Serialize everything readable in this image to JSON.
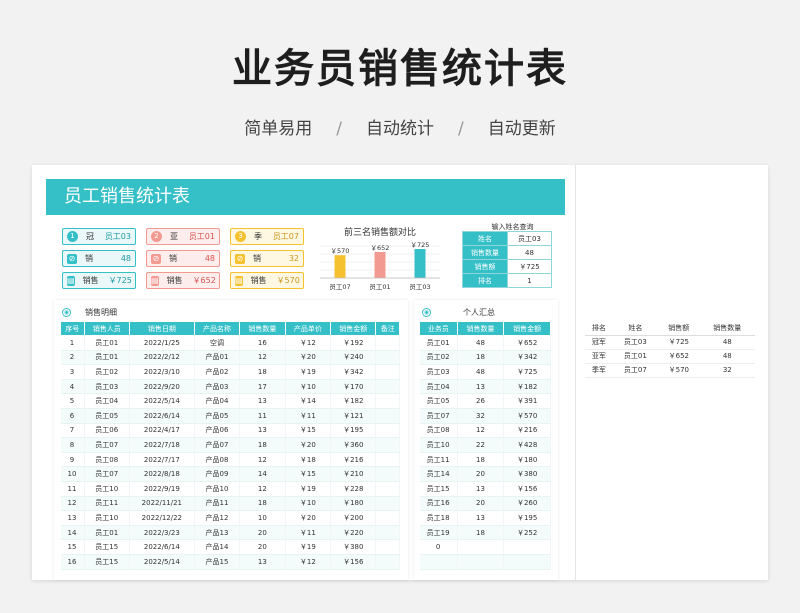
{
  "hero": {
    "title": "业务员销售统计表",
    "subtitle": [
      "简单易用",
      "自动统计",
      "自动更新"
    ]
  },
  "banner": "员工销售统计表",
  "top3": [
    {
      "rank": "1",
      "label": "冠",
      "name": "员工03",
      "sales_label": "销",
      "sales": "48",
      "amount_label": "销售",
      "amount": "￥725"
    },
    {
      "rank": "2",
      "label": "亚",
      "name": "员工01",
      "sales_label": "销",
      "sales": "48",
      "amount_label": "销售",
      "amount": "￥652"
    },
    {
      "rank": "3",
      "label": "季",
      "name": "员工07",
      "sales_label": "销",
      "sales": "32",
      "amount_label": "销售",
      "amount": "￥570"
    }
  ],
  "chart_data": {
    "type": "bar",
    "title": "前三名销售额对比",
    "categories": [
      "员工07",
      "员工01",
      "员工03"
    ],
    "values": [
      570,
      652,
      725
    ],
    "data_labels": [
      "￥570",
      "￥652",
      "￥725"
    ],
    "colors": [
      "#f5c12e",
      "#f29a92",
      "#35bfc7"
    ],
    "ylim": [
      0,
      800
    ],
    "grid": true
  },
  "lookup": {
    "title": "输入姓名查询",
    "rows": [
      {
        "k": "姓名",
        "v": "员工03"
      },
      {
        "k": "销售数量",
        "v": "48"
      },
      {
        "k": "销售额",
        "v": "￥725"
      },
      {
        "k": "排名",
        "v": "1"
      }
    ]
  },
  "detail": {
    "heading": "销售明细",
    "columns": [
      "序号",
      "销售人员",
      "销售日期",
      "产品名称",
      "销售数量",
      "产品单价",
      "销售金额",
      "备注"
    ],
    "rows": [
      [
        "1",
        "员工01",
        "2022/1/25",
        "空调",
        "16",
        "￥12",
        "￥192",
        ""
      ],
      [
        "2",
        "员工01",
        "2022/2/12",
        "产品01",
        "12",
        "￥20",
        "￥240",
        ""
      ],
      [
        "3",
        "员工02",
        "2022/3/10",
        "产品02",
        "18",
        "￥19",
        "￥342",
        ""
      ],
      [
        "4",
        "员工03",
        "2022/9/20",
        "产品03",
        "17",
        "￥10",
        "￥170",
        ""
      ],
      [
        "5",
        "员工04",
        "2022/5/14",
        "产品04",
        "13",
        "￥14",
        "￥182",
        ""
      ],
      [
        "6",
        "员工05",
        "2022/6/14",
        "产品05",
        "11",
        "￥11",
        "￥121",
        ""
      ],
      [
        "7",
        "员工06",
        "2022/4/17",
        "产品06",
        "13",
        "￥15",
        "￥195",
        ""
      ],
      [
        "8",
        "员工07",
        "2022/7/18",
        "产品07",
        "18",
        "￥20",
        "￥360",
        ""
      ],
      [
        "9",
        "员工08",
        "2022/7/17",
        "产品08",
        "12",
        "￥18",
        "￥216",
        ""
      ],
      [
        "10",
        "员工07",
        "2022/8/18",
        "产品09",
        "14",
        "￥15",
        "￥210",
        ""
      ],
      [
        "11",
        "员工10",
        "2022/9/19",
        "产品10",
        "12",
        "￥19",
        "￥228",
        ""
      ],
      [
        "12",
        "员工11",
        "2022/11/21",
        "产品11",
        "18",
        "￥10",
        "￥180",
        ""
      ],
      [
        "13",
        "员工10",
        "2022/12/22",
        "产品12",
        "10",
        "￥20",
        "￥200",
        ""
      ],
      [
        "14",
        "员工01",
        "2022/3/23",
        "产品13",
        "20",
        "￥11",
        "￥220",
        ""
      ],
      [
        "15",
        "员工15",
        "2022/6/14",
        "产品14",
        "20",
        "￥19",
        "￥380",
        ""
      ],
      [
        "16",
        "员工15",
        "2022/5/14",
        "产品15",
        "13",
        "￥12",
        "￥156",
        ""
      ]
    ]
  },
  "summary": {
    "heading": "个人汇总",
    "columns": [
      "业务员",
      "销售数量",
      "销售金额"
    ],
    "rows": [
      [
        "员工01",
        "48",
        "￥652"
      ],
      [
        "员工02",
        "18",
        "￥342"
      ],
      [
        "员工03",
        "48",
        "￥725"
      ],
      [
        "员工04",
        "13",
        "￥182"
      ],
      [
        "员工05",
        "26",
        "￥391"
      ],
      [
        "员工07",
        "32",
        "￥570"
      ],
      [
        "员工08",
        "12",
        "￥216"
      ],
      [
        "员工10",
        "22",
        "￥428"
      ],
      [
        "员工11",
        "18",
        "￥180"
      ],
      [
        "员工14",
        "20",
        "￥380"
      ],
      [
        "员工15",
        "13",
        "￥156"
      ],
      [
        "员工16",
        "20",
        "￥260"
      ],
      [
        "员工18",
        "13",
        "￥195"
      ],
      [
        "员工19",
        "18",
        "￥252"
      ],
      [
        "0",
        "",
        ""
      ],
      [
        "",
        "",
        ""
      ]
    ]
  },
  "rank_table": {
    "columns": [
      "排名",
      "姓名",
      "销售额",
      "销售数量"
    ],
    "rows": [
      [
        "冠军",
        "员工03",
        "￥725",
        "48"
      ],
      [
        "亚军",
        "员工01",
        "￥652",
        "48"
      ],
      [
        "季军",
        "员工07",
        "￥570",
        "32"
      ]
    ]
  }
}
